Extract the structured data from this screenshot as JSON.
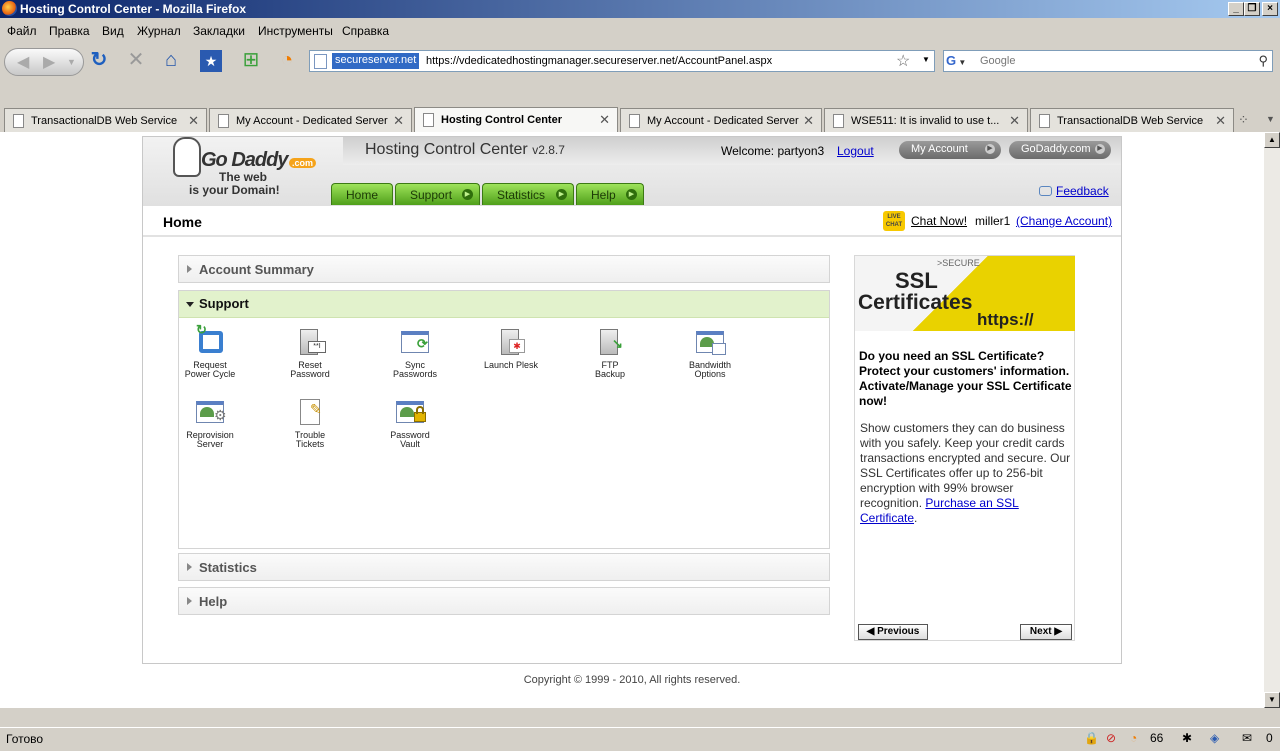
{
  "browser": {
    "window_title": "Hosting Control Center - Mozilla Firefox",
    "menu": [
      "Файл",
      "Правка",
      "Вид",
      "Журнал",
      "Закладки",
      "Инструменты",
      "Справка"
    ],
    "site_badge": "secureserver.net",
    "url": "https://vdedicatedhostingmanager.secureserver.net/AccountPanel.aspx",
    "search_placeholder": "Google",
    "tabs": [
      {
        "label": "TransactionalDB Web Service"
      },
      {
        "label": "My Account - Dedicated Server"
      },
      {
        "label": "Hosting Control Center",
        "active": true
      },
      {
        "label": "My Account - Dedicated Server"
      },
      {
        "label": "WSE511: It is invalid to use t..."
      },
      {
        "label": "TransactionalDB Web Service"
      }
    ],
    "status_text": "Готово",
    "status_count": "66",
    "status_mail": "0"
  },
  "header": {
    "logo_brand": "Go Daddy",
    "logo_com": ".com",
    "logo_tag1": "The web",
    "logo_tag2": "is your Domain!",
    "title": "Hosting Control Center",
    "version": "v2.8.7",
    "welcome": "Welcome: partyon3",
    "logout": "Logout",
    "my_account": "My Account",
    "godaddy_link": "GoDaddy.com",
    "feedback": "Feedback"
  },
  "nav_tabs": [
    "Home",
    "Support",
    "Statistics",
    "Help"
  ],
  "breadcrumb": {
    "title": "Home",
    "live_chat_badge": "LIVE CHAT",
    "chat_now": "Chat Now!",
    "user": "miller1",
    "change_account": "(Change Account)"
  },
  "panels": {
    "account_summary": "Account Summary",
    "support": "Support",
    "statistics": "Statistics",
    "help": "Help"
  },
  "support_tools": [
    {
      "line1": "Request",
      "line2": "Power Cycle",
      "icon": "power-cycle-icon"
    },
    {
      "line1": "Reset",
      "line2": "Password",
      "icon": "reset-password-icon"
    },
    {
      "line1": "Sync",
      "line2": "Passwords",
      "icon": "sync-passwords-icon"
    },
    {
      "line1": "Launch Plesk",
      "line2": "",
      "icon": "plesk-icon"
    },
    {
      "line1": "FTP",
      "line2": "Backup",
      "icon": "ftp-backup-icon"
    },
    {
      "line1": "Bandwidth",
      "line2": "Options",
      "icon": "bandwidth-icon"
    },
    {
      "line1": "Reprovision",
      "line2": "Server",
      "icon": "reprovision-icon"
    },
    {
      "line1": "Trouble",
      "line2": "Tickets",
      "icon": "trouble-tickets-icon"
    },
    {
      "line1": "Password",
      "line2": "Vault",
      "icon": "password-vault-icon"
    }
  ],
  "ad": {
    "img_secure": ">SECURE",
    "img_ssl": "SSL",
    "img_certificates": "Certificates",
    "img_https": "https://",
    "bold": "Do you need an SSL Certificate? Protect your customers' information. Activate/Manage your SSL Certificate now!",
    "text": "Show customers they can do business with you safely. Keep your credit cards transactions encrypted and secure. Our SSL Certificates offer up to 256-bit encryption with 99% browser recognition.",
    "link": "Purchase an SSL Certificate",
    "previous": "Previous",
    "next": "Next"
  },
  "footer": {
    "copyright": "Copyright © 1999 - 2010, All rights reserved."
  }
}
